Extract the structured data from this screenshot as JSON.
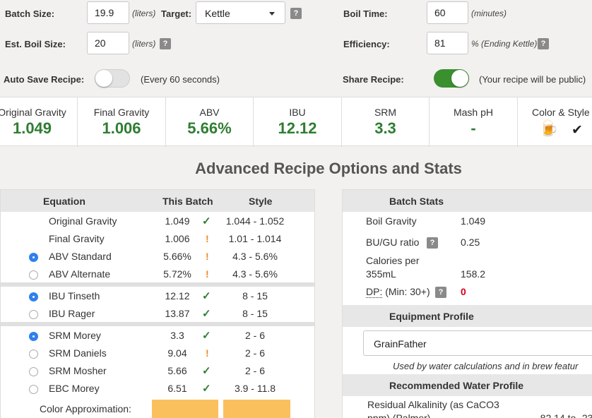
{
  "settings": {
    "batch_size_label": "Batch Size:",
    "batch_size_value": "19.9",
    "batch_size_unit": "(liters)",
    "target_label": "Target:",
    "target_value": "Kettle",
    "boil_time_label": "Boil Time:",
    "boil_time_value": "60",
    "boil_time_unit": "(minutes)",
    "est_boil_label": "Est. Boil Size:",
    "est_boil_value": "20",
    "est_boil_unit": "(liters)",
    "efficiency_label": "Efficiency:",
    "efficiency_value": "81",
    "efficiency_unit": "% (Ending Kettle)",
    "auto_save_label": "Auto Save Recipe:",
    "auto_save_note": "(Every 60 seconds)",
    "auto_save_on": false,
    "share_label": "Share Recipe:",
    "share_note": "(Your recipe will be public)",
    "share_on": true,
    "help_glyph": "?"
  },
  "stats": [
    {
      "title": "Original Gravity",
      "value": "1.049"
    },
    {
      "title": "Final Gravity",
      "value": "1.006"
    },
    {
      "title": "ABV",
      "value": "5.66%"
    },
    {
      "title": "IBU",
      "value": "12.12"
    },
    {
      "title": "SRM",
      "value": "3.3"
    },
    {
      "title": "Mash pH",
      "value": "-"
    },
    {
      "title": "Color & Style",
      "beer_glyph": "🍺",
      "check_glyph": "✔"
    }
  ],
  "section_title": "Advanced Recipe Options and Stats",
  "equations": {
    "headers": {
      "equation": "Equation",
      "batch": "This Batch",
      "style": "Style"
    },
    "rows": [
      {
        "name": "Original Gravity",
        "batch": "1.049",
        "mark": "check",
        "style": "1.044 - 1.052",
        "radio": "none"
      },
      {
        "name": "Final Gravity",
        "batch": "1.006",
        "mark": "warn",
        "style": "1.01 - 1.014",
        "radio": "none"
      },
      {
        "name": "ABV Standard",
        "batch": "5.66%",
        "mark": "warn",
        "style": "4.3 - 5.6%",
        "radio": "selected"
      },
      {
        "name": "ABV Alternate",
        "batch": "5.72%",
        "mark": "warn",
        "style": "4.3 - 5.6%",
        "radio": "unselected"
      },
      {
        "name": "IBU Tinseth",
        "batch": "12.12",
        "mark": "check",
        "style": "8 - 15",
        "radio": "selected"
      },
      {
        "name": "IBU Rager",
        "batch": "13.87",
        "mark": "check",
        "style": "8 - 15",
        "radio": "unselected"
      },
      {
        "name": "SRM Morey",
        "batch": "3.3",
        "mark": "check",
        "style": "2 - 6",
        "radio": "selected"
      },
      {
        "name": "SRM Daniels",
        "batch": "9.04",
        "mark": "warn",
        "style": "2 - 6",
        "radio": "unselected"
      },
      {
        "name": "SRM Mosher",
        "batch": "5.66",
        "mark": "check",
        "style": "2 - 6",
        "radio": "unselected"
      },
      {
        "name": "EBC Morey",
        "batch": "6.51",
        "mark": "check",
        "style": "3.9 - 11.8",
        "radio": "unselected"
      }
    ],
    "color_approx_label": "Color Approximation:",
    "swatch_color": "#fbc05e",
    "check_glyph": "✓",
    "warn_glyph": "!"
  },
  "batch_stats": {
    "header": "Batch Stats",
    "boil_gravity_label": "Boil Gravity",
    "boil_gravity_value": "1.049",
    "bugu_label": "BU/GU ratio",
    "bugu_value": "0.25",
    "calories_label_1": "Calories per",
    "calories_label_2": "355mL",
    "calories_value": "158.2",
    "dp_label": "DP:",
    "dp_min": "(Min: 30+)",
    "dp_value": "0"
  },
  "equipment": {
    "header": "Equipment Profile",
    "selected": "GrainFather",
    "note": "Used by water calculations and in brew featur"
  },
  "water": {
    "header": "Recommended Water Profile",
    "residual_label_1": "Residual Alkalinity (as CaCO3",
    "residual_label_2": "ppm) (Palmer)",
    "residual_value": "-82.14 to -23"
  },
  "colors": {
    "accent_green": "#2f7d32",
    "toggle_on": "#3a8f2f",
    "warning": "#f08a24",
    "radio_selected": "#2f80ed",
    "dp_red": "#d0021b"
  }
}
